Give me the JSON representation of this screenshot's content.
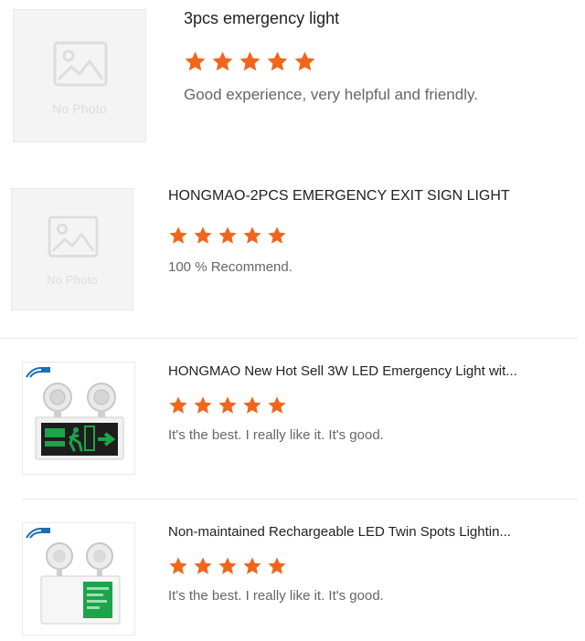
{
  "reviews": [
    {
      "title": "3pcs emergency light",
      "rating": 5,
      "comment": "Good experience, very helpful and friendly.",
      "thumbnail": "No Photo"
    },
    {
      "title": "HONGMAO-2PCS EMERGENCY EXIT SIGN LIGHT",
      "rating": 5,
      "comment": "100 % Recommend.",
      "thumbnail": "No Photo"
    },
    {
      "title": "HONGMAO New Hot Sell 3W LED Emergency Light wit...",
      "rating": 5,
      "comment": "It's the best. I really like it. It's good.",
      "thumbnail": "product-image-exit-sign-twin-spot"
    },
    {
      "title": "Non-maintained Rechargeable LED Twin Spots Lightin...",
      "rating": 5,
      "comment": "It's the best. I really like it. It's good.",
      "thumbnail": "product-image-twin-spot-box"
    }
  ],
  "colors": {
    "star": "#f0661d",
    "title": "#222222",
    "comment": "#666666",
    "divider": "#e6e6e6",
    "placeholder": "#dcdcdc"
  }
}
